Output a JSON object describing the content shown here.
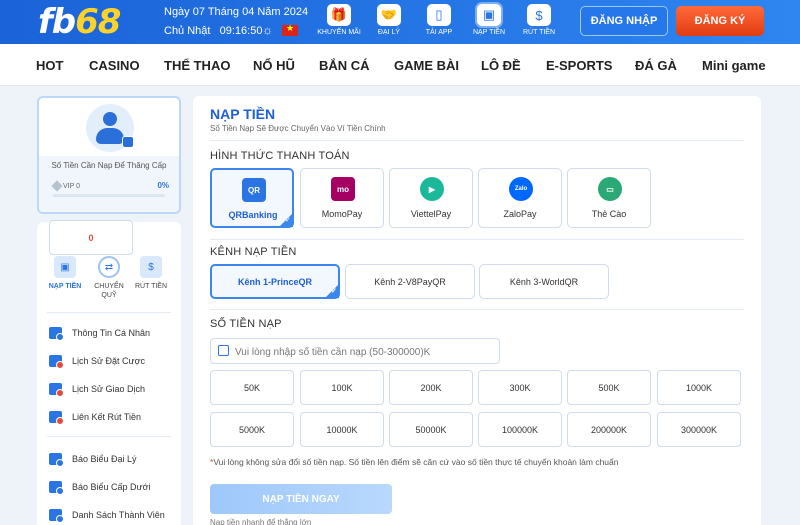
{
  "header": {
    "logo_fb": "fb",
    "logo_num": "68",
    "date_line": "Ngày 07 Tháng 04 Năm 2024",
    "day_time": "Chủ Nhật   09:16:50",
    "quick_links": [
      {
        "label": "KHUYẾN MÃI",
        "icon": "gift-icon"
      },
      {
        "label": "ĐẠI LÝ",
        "icon": "handshake-icon"
      },
      {
        "label": "TẢI APP",
        "icon": "phone-icon"
      },
      {
        "label": "NẠP TIỀN",
        "icon": "wallet-icon"
      },
      {
        "label": "RÚT TIỀN",
        "icon": "money-bag-icon"
      }
    ],
    "login_label": "ĐĂNG NHẬP",
    "register_label": "ĐĂNG KÝ"
  },
  "nav": {
    "items": [
      "HOT",
      "CASINO",
      "THỂ THAO",
      "NỔ HŨ",
      "BẮN CÁ",
      "GAME BÀI",
      "LÔ ĐỀ",
      "E-SPORTS",
      "ĐÁ GÀ",
      "Mini game"
    ]
  },
  "profile": {
    "need_text": "Số Tiền Cần Nạp Để Thăng Cấp",
    "vip_label": "VIP 0",
    "progress_text": "0%",
    "progress": 0
  },
  "sidebar": {
    "balance": "0",
    "actions": [
      {
        "label": "NẠP TIỀN",
        "icon": "wallet-icon"
      },
      {
        "label": "CHUYỂN QUỸ",
        "icon": "transfer-icon"
      },
      {
        "label": "RÚT TIỀN",
        "icon": "money-bag-icon"
      }
    ],
    "menu": [
      "Thông Tin Cá Nhân",
      "Lịch Sử Đặt Cược",
      "Lịch Sử Giao Dịch",
      "Liên Kết Rút Tiền",
      "Báo Biểu Đại Lý",
      "Báo Biểu Cấp Dưới",
      "Danh Sách Thành Viên"
    ]
  },
  "main": {
    "title": "NẠP TIỀN",
    "subtitle": "Số Tiền Nạp Sẽ Được Chuyển Vào Ví Tiền Chính",
    "payment_section": "HÌNH THỨC THANH TOÁN",
    "payment_methods": [
      {
        "name": "QRBanking",
        "logo": "QR",
        "color": "#2b74e4"
      },
      {
        "name": "MomoPay",
        "logo": "mo",
        "color": "#a50064"
      },
      {
        "name": "ViettelPay",
        "logo": "▶",
        "color": "#1bb99a"
      },
      {
        "name": "ZaloPay",
        "logo": "Zalo",
        "color": "#0068ff"
      },
      {
        "name": "Thẻ Cào",
        "logo": "▭",
        "color": "#2aa876"
      }
    ],
    "channel_section": "KÊNH NẠP TIỀN",
    "channels": [
      "Kênh 1-PrinceQR",
      "Kênh 2-V8PayQR",
      "Kênh 3-WorldQR"
    ],
    "amount_section": "SỐ TIỀN NẠP",
    "amount_placeholder": "Vui lòng nhập số tiền cần nạp (50-300000)K",
    "amounts_row1": [
      "50K",
      "100K",
      "200K",
      "300K",
      "500K",
      "1000K"
    ],
    "amounts_row2": [
      "5000K",
      "10000K",
      "50000K",
      "100000K",
      "200000K",
      "300000K"
    ],
    "note_star": "*",
    "note": "Vui lòng không sửa đổi số tiền nạp. Số tiền lên điểm sẽ căn cứ vào số tiền thực tế chuyển khoản làm chuẩn",
    "submit_label": "NẠP TIỀN NGAY",
    "cut_text": "Nạp tiền nhanh để thắng lớn"
  }
}
